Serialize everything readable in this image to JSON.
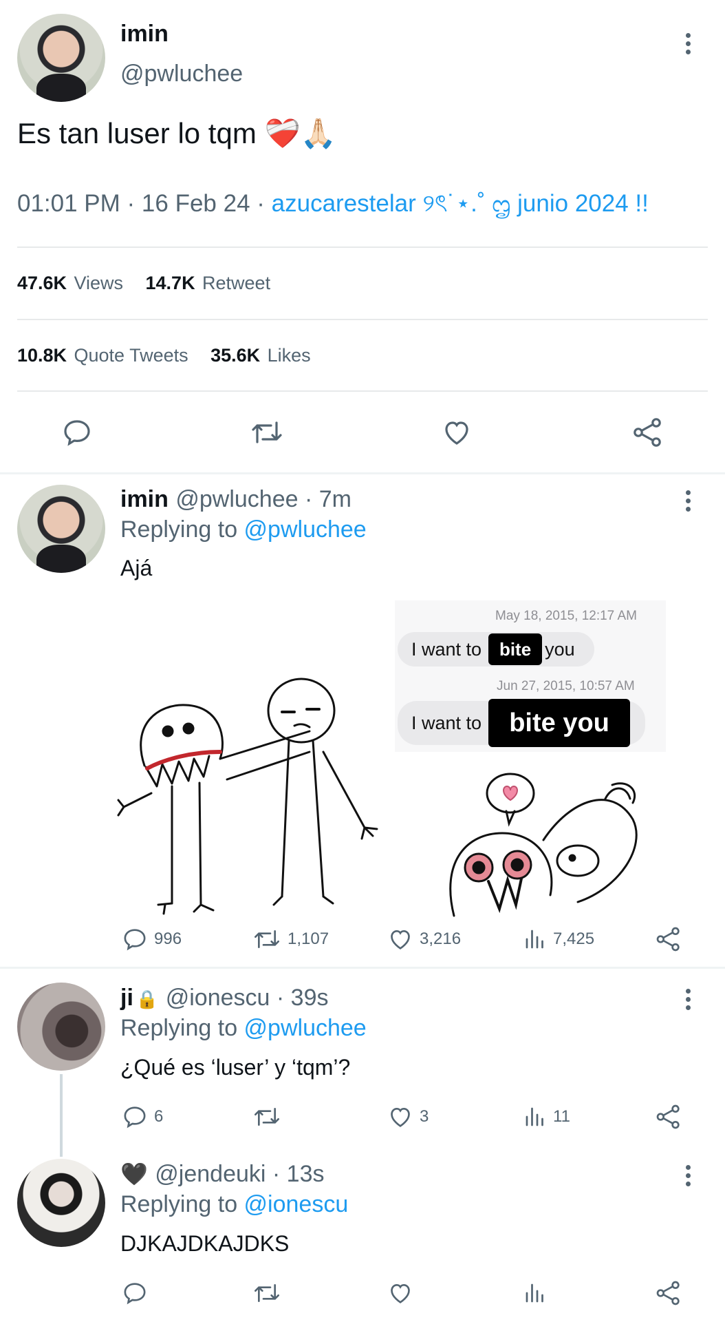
{
  "main_tweet": {
    "display_name": "imin",
    "handle": "@pwluchee",
    "text": "Es tan luser lo tqm ❤️‍🩹🙏🏻",
    "time": "01:01 PM · 16 Feb 24 · ",
    "source": "azucarestelar ୨ৎ˙⋆.˚ ᦗ junio 2024 !!",
    "stats": {
      "views_num": "47.6K",
      "views_label": "Views",
      "retweet_num": "14.7K",
      "retweet_label": "Retweet",
      "quotes_num": "10.8K",
      "quotes_label": "Quote Tweets",
      "likes_num": "35.6K",
      "likes_label": "Likes"
    }
  },
  "replies": [
    {
      "display_name": "imin",
      "meta": "@pwluchee · 7m",
      "replying_prefix": "Replying to ",
      "replying_to": "@pwluchee",
      "text": "Ajá",
      "counts": {
        "reply": "996",
        "retweet": "1,107",
        "like": "3,216",
        "views": "7,425"
      },
      "image": {
        "ts1": "May 18, 2015, 12:17 AM",
        "ts2": "Jun 27, 2015, 10:57 AM",
        "bubble_text": "I want to",
        "tag1": "bite",
        "after1": "you",
        "tag2": "bite you"
      }
    },
    {
      "display_name": "ji",
      "lock": "🔒",
      "meta": "@ionescu · 39s",
      "replying_prefix": "Replying to ",
      "replying_to": "@pwluchee",
      "text": "¿Qué es ‘luser’ y ‘tqm’?",
      "counts": {
        "reply": "6",
        "retweet": "",
        "like": "3",
        "views": "11"
      }
    },
    {
      "display_name": "🖤",
      "meta": "@jendeuki · 13s",
      "replying_prefix": "Replying to ",
      "replying_to": "@ionescu",
      "text": "DJKAJDKAJDKS",
      "counts": {
        "reply": "",
        "retweet": "",
        "like": "",
        "views": ""
      }
    }
  ],
  "colors": {
    "accent": "#1d9bf0",
    "muted": "#536471",
    "text": "#0f1419",
    "divider": "#e7e9ea"
  }
}
